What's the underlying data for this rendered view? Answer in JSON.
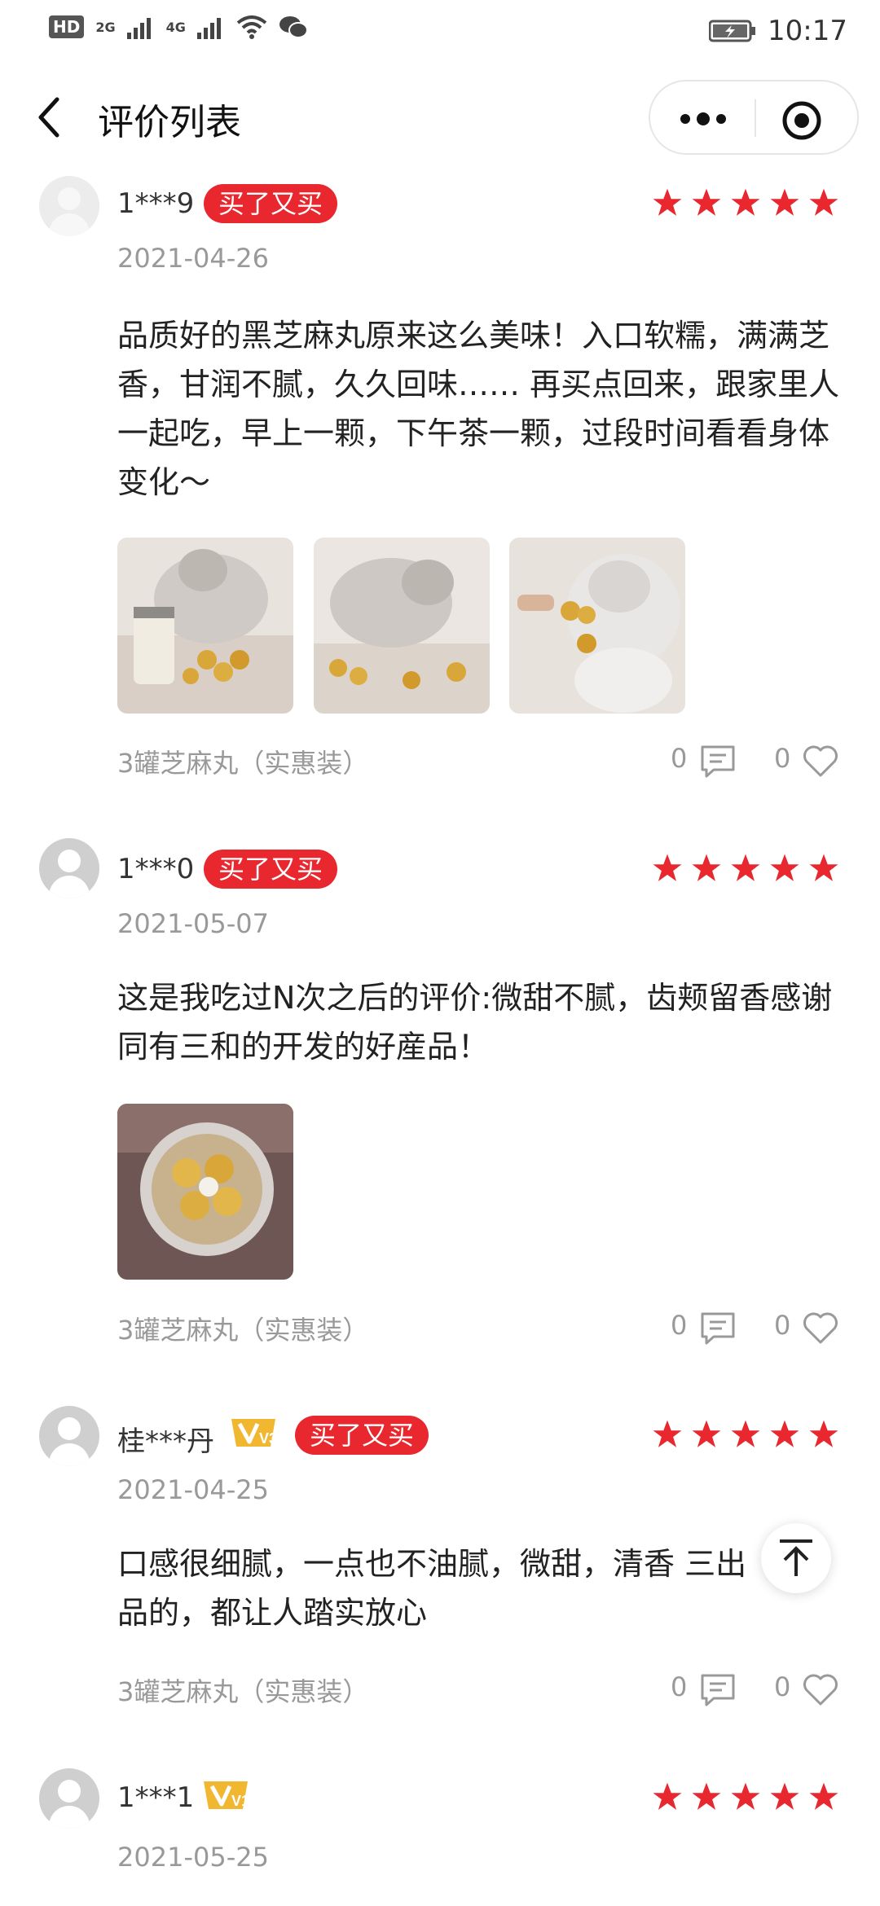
{
  "status_bar": {
    "hd": "HD",
    "sim1": "2G",
    "sim2": "4G",
    "time": "10:17",
    "wifi_icon": "wifi-icon",
    "wechat_icon": "wechat-icon",
    "battery_icon": "battery-charging-icon"
  },
  "header": {
    "title": "评价列表",
    "back_icon": "back-chevron-icon",
    "more_icon": "more-dots-icon",
    "close_icon": "target-close-icon"
  },
  "colors": {
    "accent": "#e8272f",
    "gold": "#f2b731",
    "muted": "#999999"
  },
  "reviews": [
    {
      "user": "1***9",
      "vip": "",
      "badge": "买了又买",
      "rating": 5,
      "date": "2021-04-26",
      "content": "品质好的黑芝麻丸原来这么美味！入口软糯，满满芝香，甘润不腻，久久回味…… 再买点回来，跟家里人一起吃，早上一颗，下午茶一颗，过段时间看看身体变化～",
      "images": [
        "cat-with-jar-photo",
        "cat-with-balls-photo",
        "cat-eating-ball-photo"
      ],
      "spec": "3罐芝麻丸（实惠装）",
      "comments": "0",
      "likes": "0"
    },
    {
      "user": "1***0",
      "vip": "",
      "badge": "买了又买",
      "rating": 5,
      "date": "2021-05-07",
      "content": "这是我吃过N次之后的评价:微甜不腻，齿颊留香感谢同有三和的开发的好産品！",
      "images": [
        "jar-top-view-photo"
      ],
      "spec": "3罐芝麻丸（实惠装）",
      "comments": "0",
      "likes": "0"
    },
    {
      "user": "桂***丹",
      "vip": "V3",
      "badge": "买了又买",
      "rating": 5,
      "date": "2021-04-25",
      "content": "口感很细腻，一点也不油腻，微甜，清香 三出品的，都让人踏实放心",
      "images": [],
      "spec": "3罐芝麻丸（实惠装）",
      "comments": "0",
      "likes": "0"
    },
    {
      "user": "1***1",
      "vip": "V1",
      "badge": "",
      "rating": 5,
      "date": "2021-05-25",
      "content": "",
      "images": [],
      "spec": "",
      "comments": "",
      "likes": ""
    }
  ],
  "fab": {
    "icon": "scroll-to-top-icon"
  }
}
